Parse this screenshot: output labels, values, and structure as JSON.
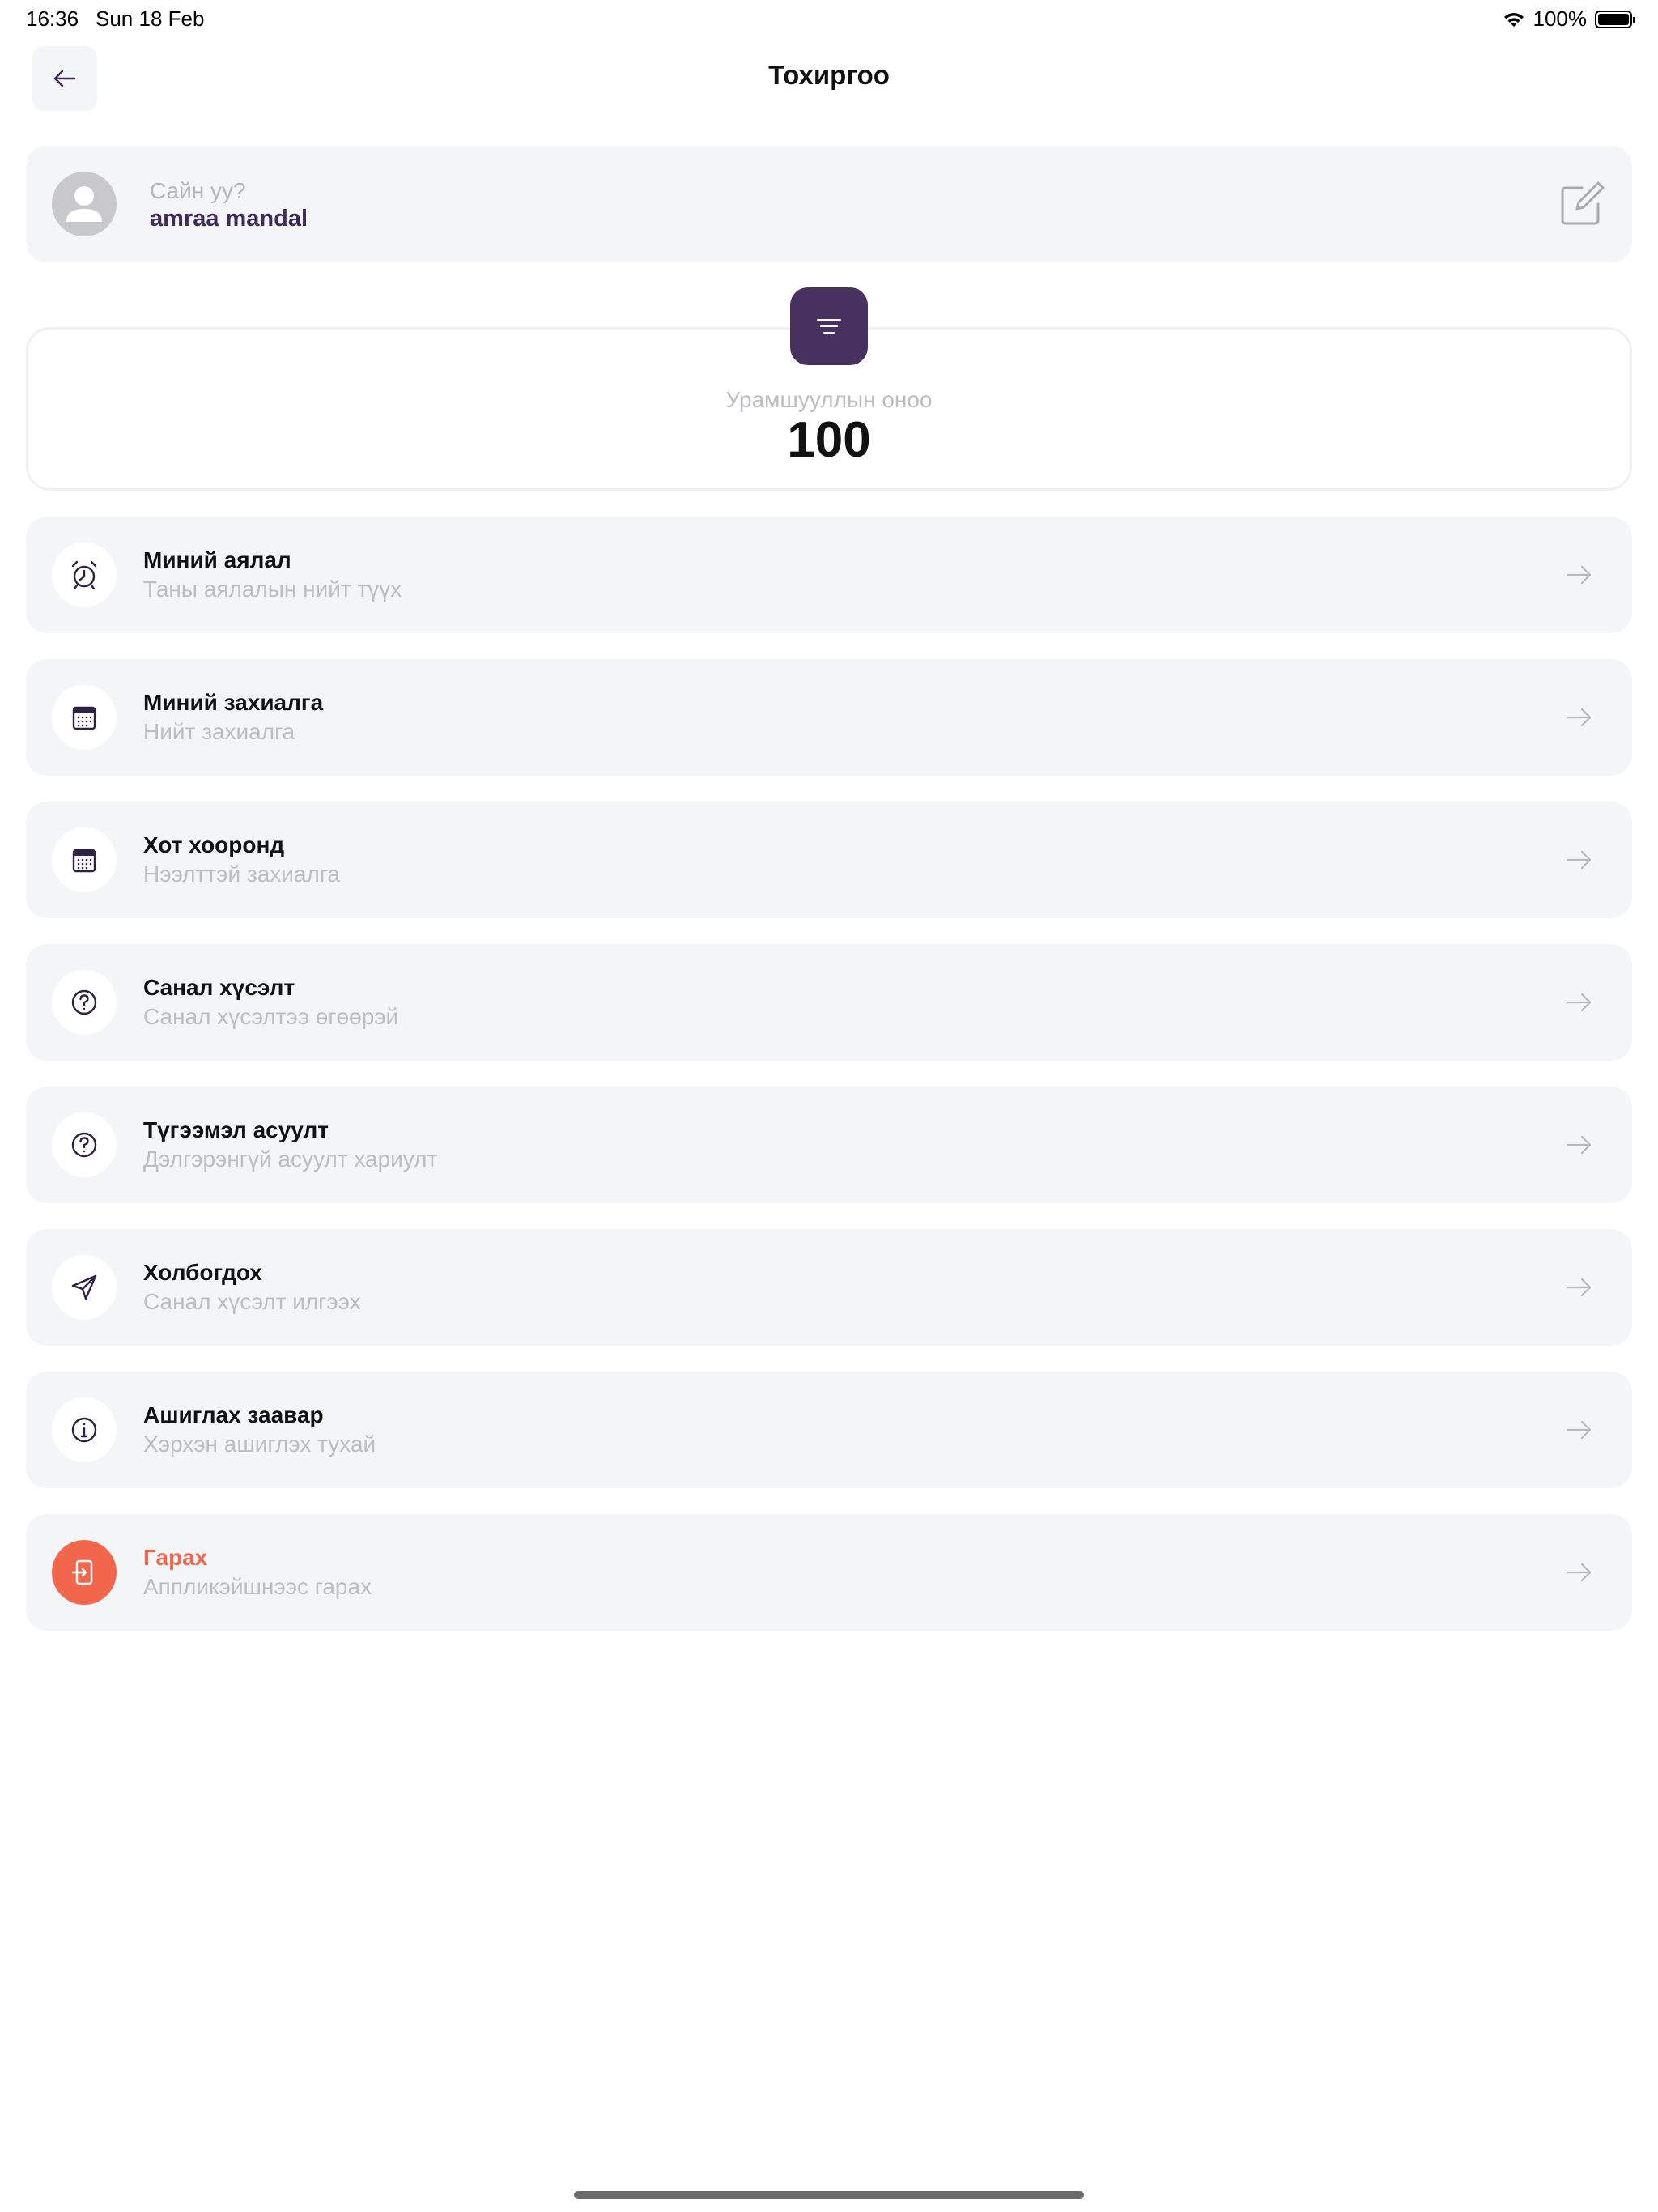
{
  "status_bar": {
    "time": "16:36",
    "date": "Sun 18 Feb",
    "battery": "100%",
    "battery_level": 1.0
  },
  "header": {
    "title": "Тохиргоо",
    "back_icon": "arrow-left-icon"
  },
  "profile": {
    "greeting": "Сайн уу?",
    "name": "amraa mandal",
    "avatar_icon": "user-avatar-icon",
    "edit_icon": "edit-icon"
  },
  "points": {
    "label": "Урамшууллын оноо",
    "value": "100",
    "icon": "menu-lines-icon"
  },
  "menu": {
    "items": [
      {
        "title": "Миний аялал",
        "subtitle": "Таны аялалын нийт түүх",
        "icon": "alarm-clock-icon"
      },
      {
        "title": "Миний захиалга",
        "subtitle": "Нийт захиалга",
        "icon": "calendar-icon"
      },
      {
        "title": "Хот хооронд",
        "subtitle": "Нээлттэй захиалга",
        "icon": "calendar-icon"
      },
      {
        "title": "Санал хүсэлт",
        "subtitle": "Санал хүсэлтээ өгөөрэй",
        "icon": "question-circle-icon"
      },
      {
        "title": "Түгээмэл асуулт",
        "subtitle": "Дэлгэрэнгүй асуулт хариулт",
        "icon": "question-circle-icon"
      },
      {
        "title": "Холбогдох",
        "subtitle": "Санал хүсэлт илгээх",
        "icon": "send-icon"
      },
      {
        "title": "Ашиглах заавар",
        "subtitle": "Хэрхэн ашиглэх тухай",
        "icon": "info-circle-icon"
      },
      {
        "title": "Гарах",
        "subtitle": "Аппликэйшнээс гарах",
        "icon": "logout-icon"
      }
    ],
    "arrow_icon": "arrow-right-icon"
  },
  "colors": {
    "brand": "#46315f",
    "logout": "#f2674c",
    "card_bg": "#f4f5f7"
  }
}
